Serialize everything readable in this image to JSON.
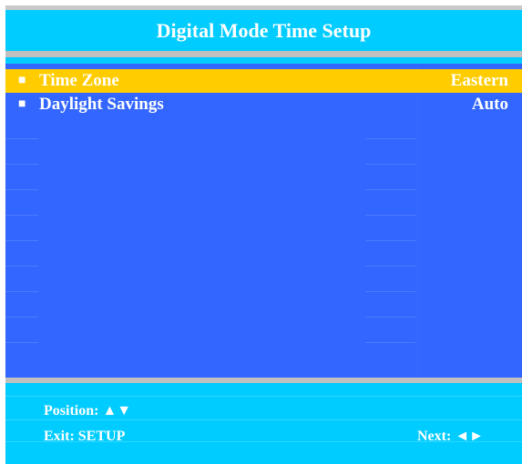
{
  "header": {
    "title": "Digital Mode Time Setup"
  },
  "menu": {
    "items": [
      {
        "bullet": "■",
        "label": "Time Zone",
        "value": "Eastern",
        "selected": true
      },
      {
        "bullet": "■",
        "label": "Daylight Savings",
        "value": "Auto",
        "selected": false
      }
    ]
  },
  "footer": {
    "position_hint": "Position: ▲▼",
    "exit_hint": "Exit: SETUP",
    "next_hint": "Next: ◄►"
  },
  "colors": {
    "frame": "#00ccff",
    "list_background": "#3366ff",
    "highlight": "#ffcc00",
    "rule": "#c0c0c0",
    "text": "#ffffff"
  }
}
